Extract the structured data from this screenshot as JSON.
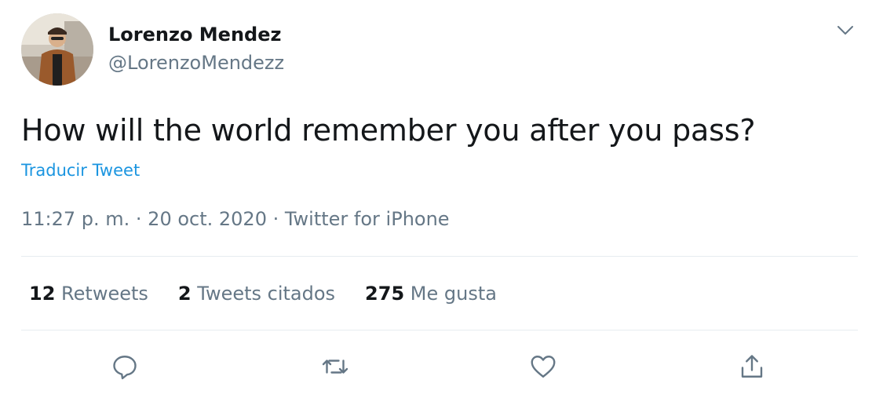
{
  "author": {
    "name": "Lorenzo Mendez",
    "handle": "@LorenzoMendezz"
  },
  "tweet": {
    "text": "How will the world remember you after you pass?",
    "translate_label": "Traducir Tweet",
    "meta": "11:27 p. m. · 20 oct. 2020 · Twitter for iPhone"
  },
  "stats": {
    "retweets_count": "12",
    "retweets_label": "Retweets",
    "quotes_count": "2",
    "quotes_label": "Tweets citados",
    "likes_count": "275",
    "likes_label": "Me gusta"
  },
  "icons": {
    "more": "chevron-down-icon",
    "reply": "reply-icon",
    "retweet": "retweet-icon",
    "like": "heart-icon",
    "share": "share-icon"
  },
  "colors": {
    "text": "#14171a",
    "secondary": "#657786",
    "link": "#1b95e0",
    "divider": "#e6ecf0"
  }
}
